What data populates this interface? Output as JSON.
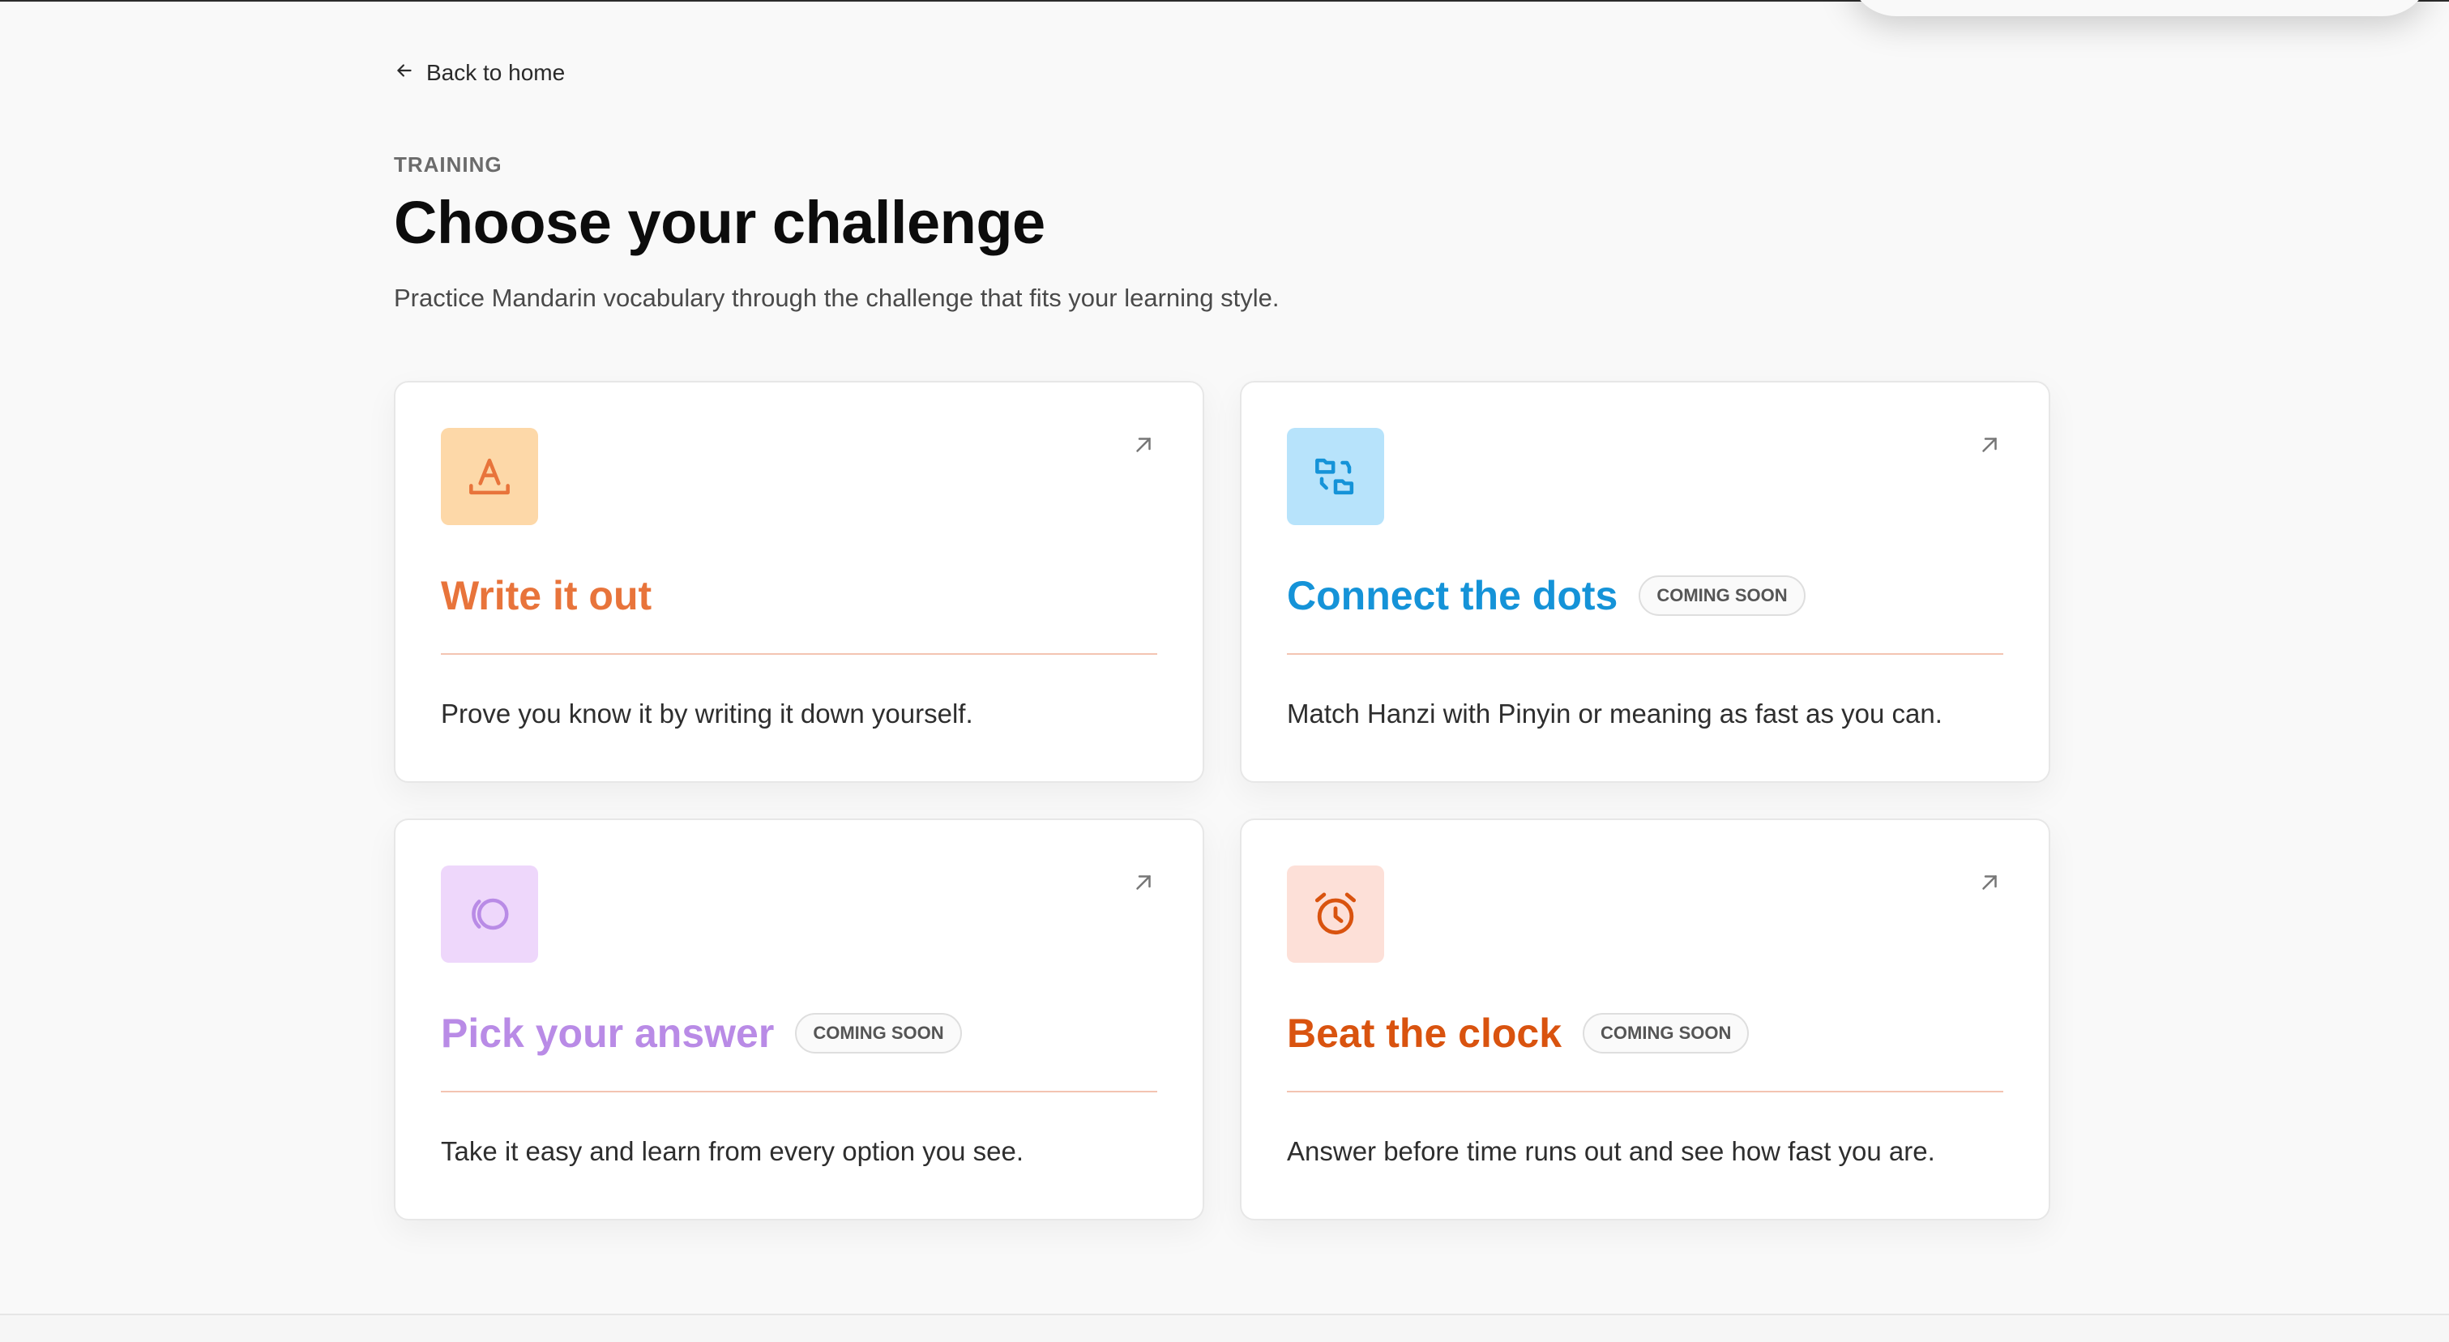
{
  "nav": {
    "back_label": "Back to home"
  },
  "header": {
    "eyebrow": "TRAINING",
    "title": "Choose your challenge",
    "subtitle": "Practice Mandarin vocabulary through the challenge that fits your learning style."
  },
  "cards": [
    {
      "title": "Write it out",
      "badge": "",
      "description": "Prove you know it by writing it down yourself.",
      "icon": "handwriting-icon",
      "accent_color": "#e8743b",
      "icon_bg": "#fdd8a8"
    },
    {
      "title": "Connect the dots",
      "badge": "COMING SOON",
      "description": "Match Hanzi with Pinyin or meaning as fast as you can.",
      "icon": "connect-icon",
      "accent_color": "#1593d8",
      "icon_bg": "#b7e3fb"
    },
    {
      "title": "Pick your answer",
      "badge": "COMING SOON",
      "description": "Take it easy and learn from every option you see.",
      "icon": "choice-icon",
      "accent_color": "#b98be6",
      "icon_bg": "#eed7fb"
    },
    {
      "title": "Beat the clock",
      "badge": "COMING SOON",
      "description": "Answer before time runs out and see how fast you are.",
      "icon": "alarm-clock-icon",
      "accent_color": "#d9530f",
      "icon_bg": "#fde0d8"
    }
  ]
}
